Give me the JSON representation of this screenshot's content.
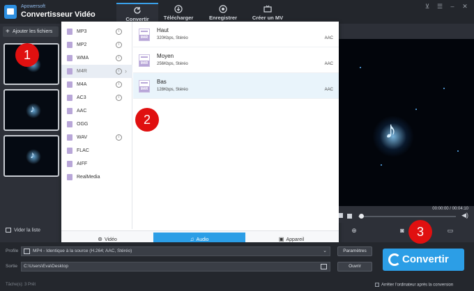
{
  "app": {
    "brand": "Apowersoft",
    "title": "Convertisseur Vidéo"
  },
  "tabs": [
    {
      "label": "Convertir",
      "icon": "refresh-icon",
      "active": true
    },
    {
      "label": "Télécharger",
      "icon": "download-icon",
      "active": false
    },
    {
      "label": "Enregistrer",
      "icon": "record-icon",
      "active": false
    },
    {
      "label": "Créer un MV",
      "icon": "tv-icon",
      "active": false
    }
  ],
  "left": {
    "add_files": "Ajouter les fichiers",
    "clear_list": "Vider la liste"
  },
  "badges": [
    "1",
    "2",
    "3"
  ],
  "formats": [
    {
      "name": "MP3",
      "info": true
    },
    {
      "name": "MP2",
      "info": true
    },
    {
      "name": "WMA",
      "info": true
    },
    {
      "name": "M4R",
      "info": true,
      "selected": true
    },
    {
      "name": "M4A",
      "info": true
    },
    {
      "name": "AC3",
      "info": true
    },
    {
      "name": "AAC",
      "info": false
    },
    {
      "name": "OGG",
      "info": false
    },
    {
      "name": "WAV",
      "info": true
    },
    {
      "name": "FLAC",
      "info": false
    },
    {
      "name": "AIFF",
      "info": false
    },
    {
      "name": "RealMedia",
      "info": false
    }
  ],
  "qualities": [
    {
      "name": "Haut",
      "desc": "320Kbps, Stéréo",
      "codec": "AAC",
      "icon_text": "M4R"
    },
    {
      "name": "Moyen",
      "desc": "256Kbps, Stéréo",
      "codec": "AAC",
      "icon_text": "M4R"
    },
    {
      "name": "Bas",
      "desc": "128Kbps, Stéréo",
      "codec": "AAC",
      "icon_text": "M4R",
      "selected": true
    }
  ],
  "dropdown_tabs": [
    {
      "label": "Vidéo",
      "icon": "film-icon",
      "active": false
    },
    {
      "label": "Audio",
      "icon": "headphones-icon",
      "active": true
    },
    {
      "label": "Appareil",
      "icon": "device-icon",
      "active": false
    }
  ],
  "player": {
    "time": "00:00:00 / 00:04:10",
    "progress": 0.0
  },
  "bottom": {
    "profile_label": "Profile",
    "profile_value": "MP4 - Identique à la source (H.264; AAC, Stéréo)",
    "output_label": "Sortie",
    "output_value": "C:\\Users\\Eva\\Desktop",
    "params_button": "Paramètres",
    "open_button": "Ouvrir",
    "convert_button": "Convertir",
    "status": "Tâche(s): 3    Prêt",
    "shutdown_label": "Arrêter l'ordinateur après la conversion"
  },
  "colors": {
    "accent": "#2c9ee6",
    "badge": "#e01010"
  }
}
